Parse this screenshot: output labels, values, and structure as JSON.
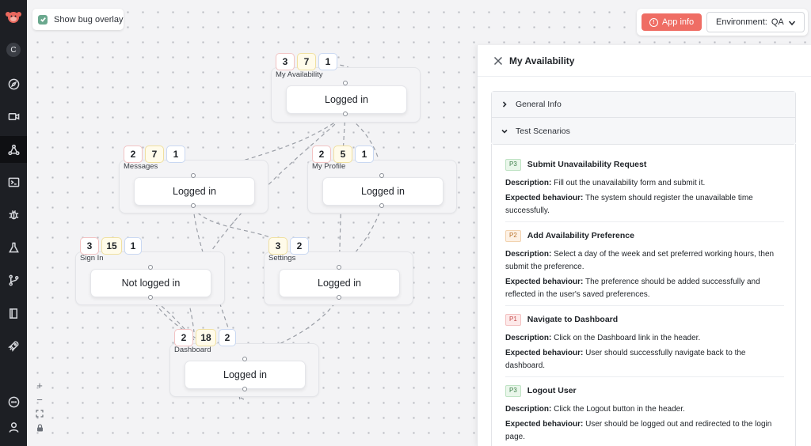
{
  "overlay": {
    "label": "Show bug overlay",
    "checked": true
  },
  "topbar": {
    "app_info_label": "App info",
    "env_label": "Environment:",
    "env_value": "QA"
  },
  "sidebar": {
    "avatar_letter": "C",
    "items": [
      {
        "name": "compass-icon"
      },
      {
        "name": "video-icon"
      },
      {
        "name": "graph-icon",
        "active": true
      },
      {
        "name": "terminal-icon"
      },
      {
        "name": "bug-icon"
      },
      {
        "name": "flask-icon"
      },
      {
        "name": "git-branch-icon"
      },
      {
        "name": "book-icon"
      },
      {
        "name": "rocket-icon"
      },
      {
        "name": "chat-icon"
      },
      {
        "name": "user-icon"
      }
    ]
  },
  "graph": {
    "nodes": [
      {
        "id": "my-availability",
        "label": "My Availability",
        "state": "Logged in",
        "badges": [
          "3",
          "7",
          "1"
        ]
      },
      {
        "id": "messages",
        "label": "Messages",
        "state": "Logged in",
        "badges": [
          "2",
          "7",
          "1"
        ]
      },
      {
        "id": "my-profile",
        "label": "My Profile",
        "state": "Logged in",
        "badges": [
          "2",
          "5",
          "1"
        ]
      },
      {
        "id": "sign-in",
        "label": "Sign In",
        "state": "Not logged in",
        "badges": [
          "3",
          "15",
          "1"
        ]
      },
      {
        "id": "settings",
        "label": "Settings",
        "state": "Logged in",
        "badges": [
          "3",
          "2"
        ]
      },
      {
        "id": "dashboard",
        "label": "Dashboard",
        "state": "Logged in",
        "badges": [
          "2",
          "18",
          "2"
        ]
      }
    ]
  },
  "zoom": {
    "plus": "+",
    "minus": "−"
  },
  "panel": {
    "title": "My Availability",
    "general_info": "General Info",
    "test_scenarios": "Test Scenarios",
    "desc_label": "Description:",
    "exp_label": "Expected behaviour:",
    "scenarios": [
      {
        "priority": "P3",
        "title": "Submit Unavailability Request",
        "description": "Fill out the unavailability form and submit it.",
        "expected": "The system should register the unavailable time successfully."
      },
      {
        "priority": "P2",
        "title": "Add Availability Preference",
        "description": "Select a day of the week and set preferred working hours, then submit the preference.",
        "expected": "The preference should be added successfully and reflected in the user's saved preferences."
      },
      {
        "priority": "P1",
        "title": "Navigate to Dashboard",
        "description": "Click on the Dashboard link in the header.",
        "expected": "User should successfully navigate back to the dashboard."
      },
      {
        "priority": "P3",
        "title": "Logout User",
        "description": "Click the Logout button in the header.",
        "expected": "User should be logged out and redirected to the login page."
      }
    ]
  }
}
